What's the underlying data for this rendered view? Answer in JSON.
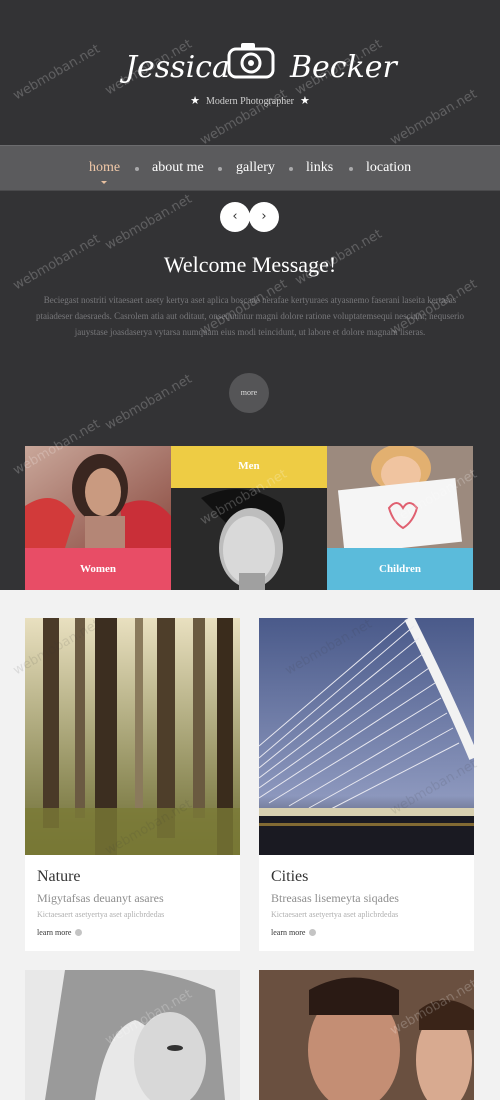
{
  "brand": {
    "first": "Jessica",
    "last": "Becker",
    "tagline": "Modern Photographer",
    "icon": "camera-icon"
  },
  "nav": [
    {
      "label": "home",
      "active": true
    },
    {
      "label": "about me",
      "active": false
    },
    {
      "label": "gallery",
      "active": false
    },
    {
      "label": "links",
      "active": false
    },
    {
      "label": "location",
      "active": false
    }
  ],
  "slider": {
    "prev": "‹",
    "next": "›"
  },
  "welcome": {
    "title": "Welcome Message!",
    "text": "Beciegast nostriti vitaesaert asety kertya aset aplica boscade nerafae kertyuraes atyasnemo faserani laseita kertasas ptaiadeser daesraeds. Casrolem atia aut oditaut, onsequuntur magni dolore ratione voluptatemsequi nesciunt, nequserio jauystase joasdaserya vytarsa numquam eius modi teincidunt, ut labore et dolore magnam liseras.",
    "more": "more"
  },
  "categories": [
    {
      "label": "Men",
      "color": "#eecc44"
    },
    {
      "label": "Women",
      "color": "#e84d66"
    },
    {
      "label": "Children",
      "color": "#5bbbdb"
    }
  ],
  "cards": [
    {
      "title": "Nature",
      "subtitle": "Migytafsas deuanyt asares",
      "desc": "Kictaesaert asetyertya aset aplicbrdedas",
      "more": "learn more"
    },
    {
      "title": "Cities",
      "subtitle": "Btreasas lisemeyta siqades",
      "desc": "Kictaesaert asetyertya aset aplicbrdedas",
      "more": "learn more"
    }
  ],
  "watermark": "webmoban.net"
}
